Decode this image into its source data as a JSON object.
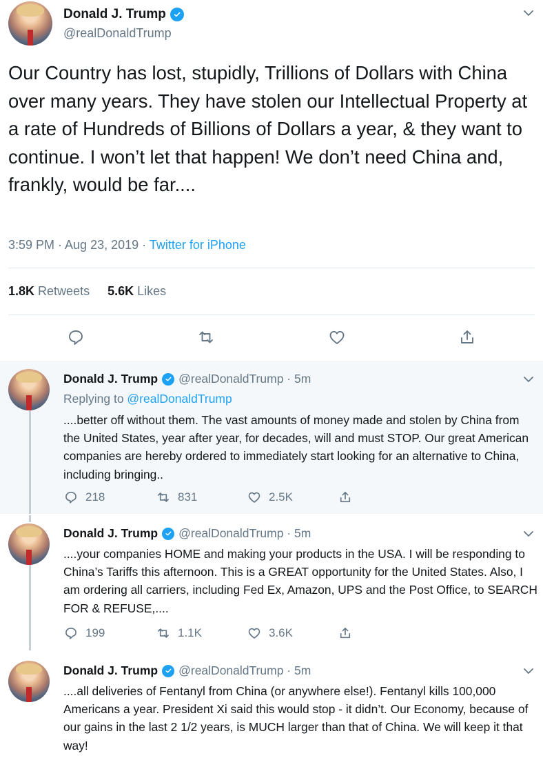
{
  "main_tweet": {
    "author_name": "Donald J. Trump",
    "handle": "@realDonaldTrump",
    "text": "Our Country has lost, stupidly, Trillions of Dollars with China over many years. They have stolen our Intellectual Property at a rate of Hundreds of Billions of Dollars a year, & they want to continue. I won’t let that happen! We don’t need China and, frankly, would be far....",
    "time": "3:59 PM · Aug 23, 2019 · ",
    "source": "Twitter for iPhone",
    "retweets_count": "1.8K",
    "retweets_label": "Retweets",
    "likes_count": "5.6K",
    "likes_label": "Likes"
  },
  "replies": [
    {
      "author_name": "Donald J. Trump",
      "handle": "@realDonaldTrump · 5m",
      "replying_prefix": "Replying to ",
      "replying_to": "@realDonaldTrump",
      "text": "....better off without them. The vast amounts of money made and stolen by China from the United States, year after year, for decades, will and must STOP. Our great American companies are hereby ordered to immediately start looking for an alternative to China, including bringing..",
      "reply_count": "218",
      "retweet_count": "831",
      "like_count": "2.5K"
    },
    {
      "author_name": "Donald J. Trump",
      "handle": "@realDonaldTrump · 5m",
      "text": "....your companies HOME and making your products in the USA. I will be responding to China’s Tariffs this afternoon. This is a GREAT opportunity for the United States. Also, I am ordering all carriers, including Fed Ex, Amazon, UPS and the Post Office, to SEARCH FOR & REFUSE,....",
      "reply_count": "199",
      "retweet_count": "1.1K",
      "like_count": "3.6K"
    },
    {
      "author_name": "Donald J. Trump",
      "handle": "@realDonaldTrump · 5m",
      "text": "....all deliveries of Fentanyl from China (or anywhere else!). Fentanyl kills 100,000 Americans a year. President Xi said this would stop - it didn’t. Our Economy, because of our gains in the last 2 1/2 years, is MUCH larger than that of China. We will keep it that way!"
    }
  ],
  "icons": {
    "verified": "verified-badge-icon",
    "reply": "reply-icon",
    "retweet": "retweet-icon",
    "like": "heart-icon",
    "share": "share-icon",
    "more": "chevron-down-icon"
  },
  "colors": {
    "accent": "#1da1f2",
    "text": "#14171a",
    "muted": "#657786",
    "reply_background": "#f5f8fa"
  }
}
